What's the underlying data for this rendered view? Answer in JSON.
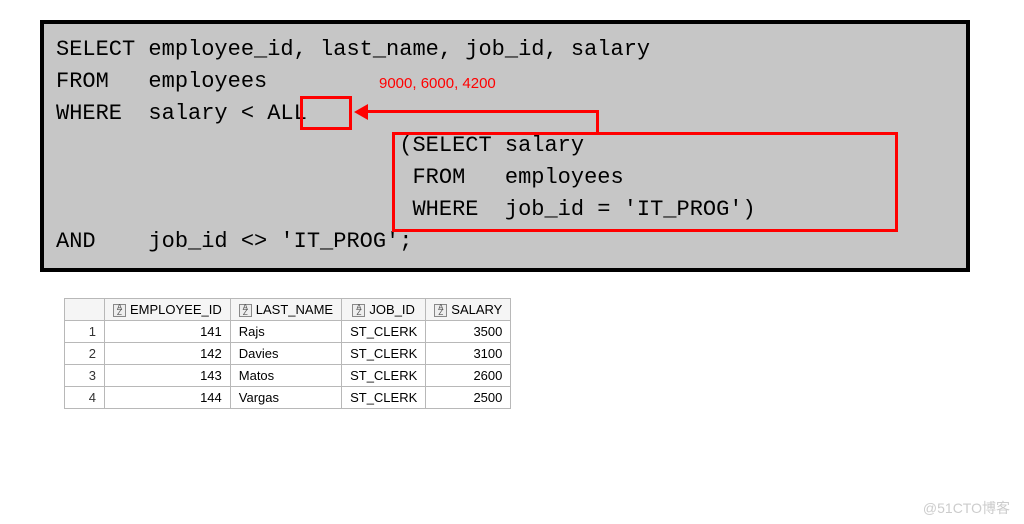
{
  "code": {
    "select": "SELECT employee_id, last_name, job_id, salary",
    "from": "FROM   employees",
    "where": "WHERE  salary < ALL",
    "sub1": "                          (SELECT salary",
    "sub2": "                           FROM   employees",
    "sub3": "                           WHERE  job_id = 'IT_PROG')",
    "and": "AND    job_id <> 'IT_PROG';"
  },
  "annotation": "9000, 6000, 4200",
  "table": {
    "headers": [
      "EMPLOYEE_ID",
      "LAST_NAME",
      "JOB_ID",
      "SALARY"
    ],
    "rows": [
      {
        "idx": "1",
        "employee_id": "141",
        "last_name": "Rajs",
        "job_id": "ST_CLERK",
        "salary": "3500"
      },
      {
        "idx": "2",
        "employee_id": "142",
        "last_name": "Davies",
        "job_id": "ST_CLERK",
        "salary": "3100"
      },
      {
        "idx": "3",
        "employee_id": "143",
        "last_name": "Matos",
        "job_id": "ST_CLERK",
        "salary": "2600"
      },
      {
        "idx": "4",
        "employee_id": "144",
        "last_name": "Vargas",
        "job_id": "ST_CLERK",
        "salary": "2500"
      }
    ]
  },
  "watermark": "@51CTO博客"
}
